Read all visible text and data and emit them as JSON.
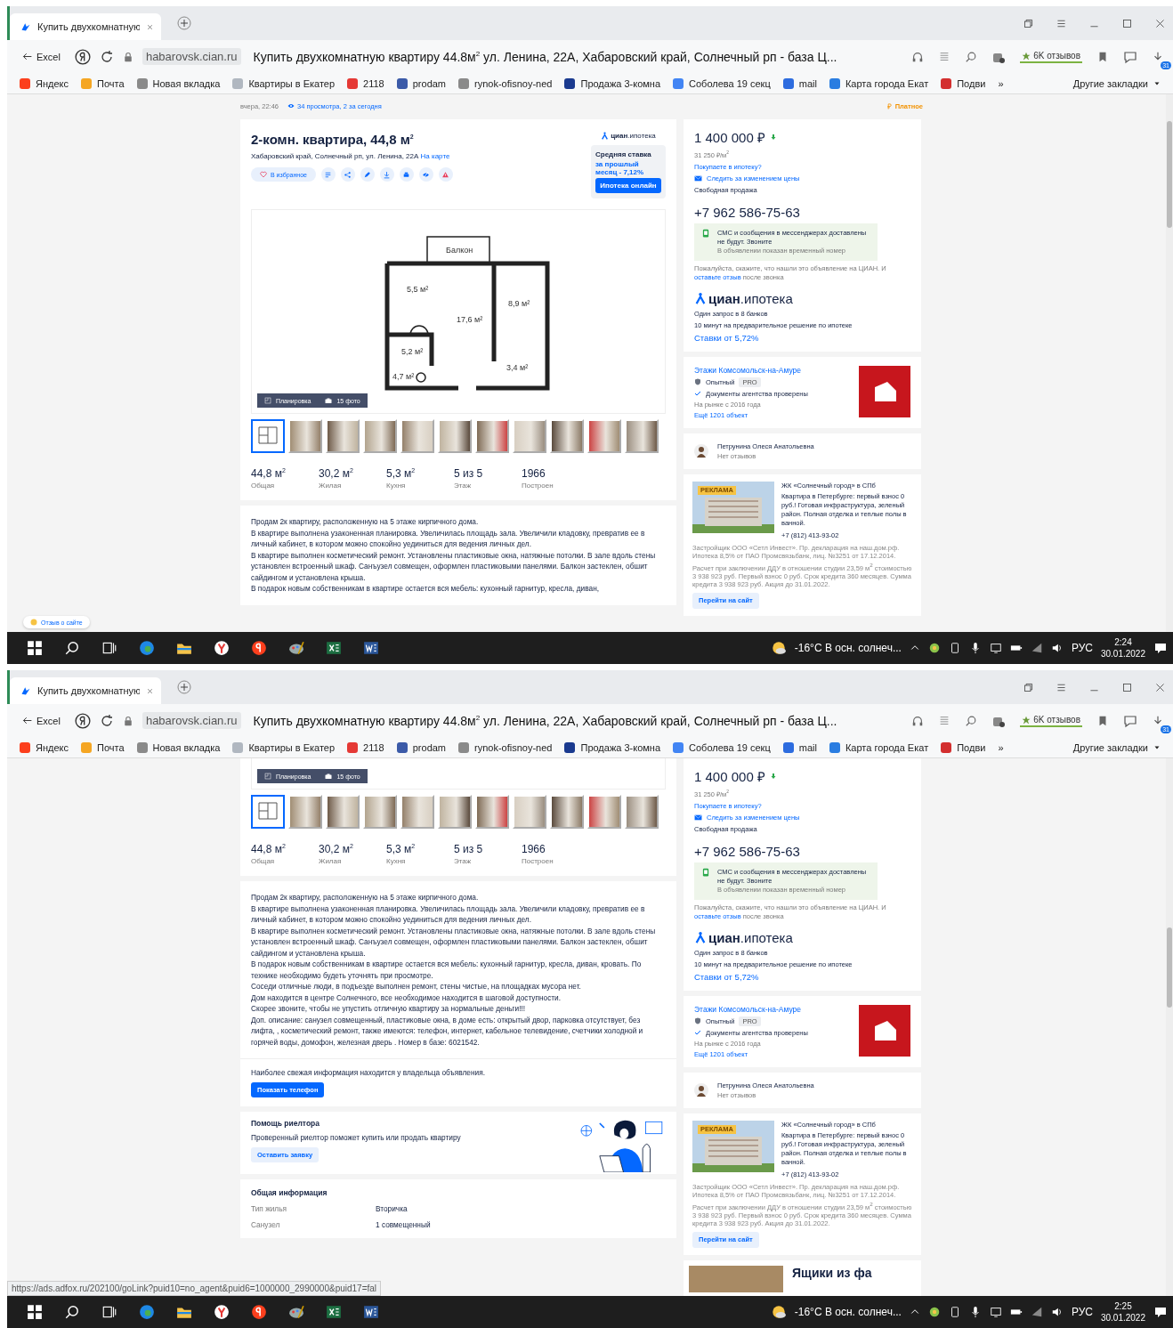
{
  "screens": [
    {
      "browser": {
        "tab_title": "Купить двухкомнатную",
        "back_label": "Excel",
        "domain": "habarovsk.cian.ru",
        "page_title": "Купить двухкомнатную квартиру 44.8м$^{2}$ ул. Ленина, 22А, Хабаровский край, Солнечный рп - база Ц...",
        "reviews": "6K отзывов",
        "download_badge": "31",
        "bookmarks": [
          {
            "label": "Яндекс",
            "color": "#fc3f1d"
          },
          {
            "label": "Почта",
            "color": "#f5a623"
          },
          {
            "label": "Новая вкладка",
            "color": "#8a8a8a"
          },
          {
            "label": "Квартиры в Екатер",
            "color": "#b0b7c0"
          },
          {
            "label": "2118",
            "color": "#e53935"
          },
          {
            "label": "prodam",
            "color": "#3b5aa8"
          },
          {
            "label": "rynok-ofisnoy-ned",
            "color": "#8a8a8a"
          },
          {
            "label": "Продажа 3-комна",
            "color": "#1a3a8f"
          },
          {
            "label": "Соболева 19 секц",
            "color": "#4285f4"
          },
          {
            "label": "mail",
            "color": "#2d6cdf"
          },
          {
            "label": "Карта города Екат",
            "color": "#2a7de1"
          },
          {
            "label": "Подви",
            "color": "#d32f2f"
          }
        ],
        "more": "»",
        "other_bookmarks": "Другие закладки"
      },
      "page": {
        "meta": {
          "posted": "вчера, 22:46",
          "views": "34 просмотра, 2 за сегодня",
          "paid": "Платное"
        },
        "header": {
          "title": "2-комн. квартира, 44,8 м$^{2}$",
          "address": "Хабаровский край, Солнечный рп, ул. Ленина, 22А",
          "map_link": "На карте",
          "favorite": "В избранное",
          "actions": [
            {
              "kind": "list"
            },
            {
              "kind": "share"
            },
            {
              "kind": "edit"
            },
            {
              "kind": "download"
            },
            {
              "kind": "print"
            },
            {
              "kind": "hide"
            },
            {
              "kind": "report"
            }
          ],
          "promo": {
            "brand": "циан",
            "suffix": ".ипотека",
            "rate_label": "Средняя ставка",
            "rate_value": "за прошлый месяц - 7,12%",
            "button": "Ипотека онлайн"
          }
        },
        "plan": {
          "labels": [
            "Балкон",
            "5,5 м²",
            "8,9 м²",
            "17,6 м²",
            "5,2 м²",
            "4,7 м²",
            "3,4 м²"
          ]
        },
        "gallery": {
          "plan_button": "Планировка",
          "photos_button": "15 фото",
          "thumbs": [
            {
              "kind": "plan",
              "selected": true
            },
            {
              "kind": "photo",
              "selected": false
            },
            {
              "kind": "photo",
              "selected": false
            },
            {
              "kind": "photo",
              "selected": false
            },
            {
              "kind": "photo",
              "selected": false
            },
            {
              "kind": "photo",
              "selected": false
            },
            {
              "kind": "photo",
              "selected": false
            },
            {
              "kind": "photo",
              "selected": false
            },
            {
              "kind": "photo",
              "selected": false
            },
            {
              "kind": "photo",
              "selected": false
            },
            {
              "kind": "photo",
              "selected": false
            }
          ]
        },
        "stats": [
          {
            "value": "44,8 м$^{2}$",
            "label": "Общая"
          },
          {
            "value": "30,2 м$^{2}$",
            "label": "Жилая"
          },
          {
            "value": "5,3 м$^{2}$",
            "label": "Кухня"
          },
          {
            "value": "5 из 5",
            "label": "Этаж"
          },
          {
            "value": "1966",
            "label": "Построен"
          }
        ],
        "description": [
          "Продам 2к квартиру, расположенную на 5 этаже кирпичного дома.",
          "В квартире выполнена узаконенная планировка. Увеличилась площадь зала. Увеличили кладовку, превратив ее в личный кабинет, в котором можно спокойно уединиться для ведения личных дел.",
          "В квартире выполнен косметический ремонт. Установлены пластиковые окна, натяжные потолки. В зале вдоль стены установлен встроенный шкаф. Санъузел совмещен, оформлен пластиковыми панелями. Балкон застеклен, обшит сайдингом и установлена крыша.",
          "В подарок новым собственникам в квартире остается вся мебель: кухонный гарнитур, кресла, диван,"
        ]
      },
      "sidebar": {
        "price": "1 400 000 ₽",
        "price_per_m2": "31 250 ₽/м$^{2}$",
        "mortgage_link": "Покупаете в ипотеку?",
        "watch_price": "Следить за изменением цены",
        "sale_type": "Свободная продажа",
        "phone": "+7 962 586-75-63",
        "notice": {
          "title": "СМС и сообщения в мессенджерах доставлены не будут. Звоните",
          "subtitle": "В объявлении показан временный номер"
        },
        "hint": {
          "before": "Пожалуйста, скажите, что нашли это объявление на ЦИАН. И ",
          "link": "оставьте отзыв",
          "after": " после звонка"
        },
        "cian": {
          "brand": "циан",
          "suffix": ".ипотека",
          "lines": [
            "Один запрос в 8 банков",
            "10 минут на предварительное решение по ипотеке"
          ],
          "rates": "Ставки от 5,72%"
        },
        "agency": {
          "name": "Этажи Комсомольск-на-Амуре",
          "level": "Опытный",
          "badge": "PRO",
          "verified": "Документы агентства проверены",
          "since": "На рынке с 2016 года",
          "more": "Ещё 1201 объект"
        },
        "agent": {
          "name": "Петрунина Олеся Анатольевна",
          "reviews": "Нет отзывов"
        },
        "ad": {
          "label": "РЕКЛАМА",
          "title": "ЖК «Солнечный город» в СПб",
          "text": "Квартира в Петербурге: первый взнос 0 руб.! Готовая инфраструктура, зеленый район. Полная отделка и теплые полы в ванной.",
          "phone": "+7 (812) 413-93-02",
          "disclaimer": "Застройщик ООО «Сетл Инвест». Пр. декларация на наш.дом.рф. Ипотека 8,5% от ПАО Промсвязьбанк, лиц. №3251 от 17.12.2014. Расчет при заключении ДДУ в отношении студии 23,59 м$^{2}$ стоимостью 3 938 923 руб. Первый взнос 0 руб. Срок кредита 360 месяцев. Сумма кредита 3 938 923 руб. Акция до 31.01.2022.",
          "button": "Перейти на сайт"
        }
      },
      "overlay": {
        "kind": "feedback",
        "text": "Отзыв о сайте"
      },
      "taskbar": {
        "weather": "-16°C  В осн. солнеч...",
        "lang": "РУС",
        "time": "2:24",
        "date": "30.01.2022"
      }
    },
    {
      "browser": {
        "tab_title": "Купить двухкомнатную",
        "back_label": "Excel",
        "domain": "habarovsk.cian.ru",
        "page_title": "Купить двухкомнатную квартиру 44.8м$^{2}$ ул. Ленина, 22А, Хабаровский край, Солнечный рп - база Ц...",
        "reviews": "6K отзывов",
        "download_badge": "31",
        "bookmarks": [
          {
            "label": "Яндекс",
            "color": "#fc3f1d"
          },
          {
            "label": "Почта",
            "color": "#f5a623"
          },
          {
            "label": "Новая вкладка",
            "color": "#8a8a8a"
          },
          {
            "label": "Квартиры в Екатер",
            "color": "#b0b7c0"
          },
          {
            "label": "2118",
            "color": "#e53935"
          },
          {
            "label": "prodam",
            "color": "#3b5aa8"
          },
          {
            "label": "rynok-ofisnoy-ned",
            "color": "#8a8a8a"
          },
          {
            "label": "Продажа 3-комна",
            "color": "#1a3a8f"
          },
          {
            "label": "Соболева 19 секц",
            "color": "#4285f4"
          },
          {
            "label": "mail",
            "color": "#2d6cdf"
          },
          {
            "label": "Карта города Екат",
            "color": "#2a7de1"
          },
          {
            "label": "Подви",
            "color": "#d32f2f"
          }
        ],
        "more": "»",
        "other_bookmarks": "Другие закладки"
      },
      "page": {
        "gallery": {
          "plan_button": "Планировка",
          "photos_button": "15 фото",
          "thumbs": [
            {
              "kind": "plan",
              "selected": true
            },
            {
              "kind": "photo",
              "selected": false
            },
            {
              "kind": "photo",
              "selected": false
            },
            {
              "kind": "photo",
              "selected": false
            },
            {
              "kind": "photo",
              "selected": false
            },
            {
              "kind": "photo",
              "selected": false
            },
            {
              "kind": "photo",
              "selected": false
            },
            {
              "kind": "photo",
              "selected": false
            },
            {
              "kind": "photo",
              "selected": false
            },
            {
              "kind": "photo",
              "selected": false
            },
            {
              "kind": "photo",
              "selected": false
            }
          ]
        },
        "stats": [
          {
            "value": "44,8 м$^{2}$",
            "label": "Общая"
          },
          {
            "value": "30,2 м$^{2}$",
            "label": "Жилая"
          },
          {
            "value": "5,3 м$^{2}$",
            "label": "Кухня"
          },
          {
            "value": "5 из 5",
            "label": "Этаж"
          },
          {
            "value": "1966",
            "label": "Построен"
          }
        ],
        "description": [
          "Продам 2к квартиру, расположенную на 5 этаже кирпичного дома.",
          "В квартире выполнена узаконенная планировка. Увеличилась площадь зала. Увеличили кладовку, превратив ее в личный кабинет, в котором можно спокойно уединиться для ведения личных дел.",
          "В квартире выполнен косметический ремонт. Установлены пластиковые окна, натяжные потолки. В зале вдоль стены установлен встроенный шкаф. Санъузел совмещен, оформлен пластиковыми панелями. Балкон застеклен, обшит сайдингом и установлена крыша.",
          "В подарок новым собственникам в квартире остается вся мебель: кухонный гарнитур, кресла, диван, кровать. По технике необходимо будеть уточнять при просмотре.",
          "Соседи отличные люди, в подъезде выполнен ремонт, стены чистые, на площадках мусора нет.",
          "Дом находится в центре Солнечного, все необходимое находится в шаговой доступности.",
          "Скорее звоните, чтобы не упустить отличную квартиру за нормальные деньги!!!",
          " Доп. описание: санузел совмещенный, пластиковые окна, в доме есть: открытый двор, парковка отсутствует, без лифта, , косметический ремонт, также имеются: телефон, интернет, кабельное телевидение, счетчики холодной и горячей воды, домофон, железная дверь . Номер в базе: 6021542."
        ],
        "owner": {
          "note": "Наиболее свежая информация находится у владельца объявления.",
          "button": "Показать телефон"
        },
        "realtor": {
          "title": "Помощь риелтора",
          "text": "Проверенный риелтор поможет купить или продать квартиру",
          "button": "Оставить заявку"
        },
        "general": {
          "title": "Общая информация",
          "rows": [
            {
              "label": "Тип жилья",
              "value": "Вторичка"
            },
            {
              "label": "Санузел",
              "value": "1 совмещенный"
            }
          ]
        }
      },
      "sidebar": {
        "price": "1 400 000 ₽",
        "price_per_m2": "31 250 ₽/м$^{2}$",
        "mortgage_link": "Покупаете в ипотеку?",
        "watch_price": "Следить за изменением цены",
        "sale_type": "Свободная продажа",
        "phone": "+7 962 586-75-63",
        "notice": {
          "title": "СМС и сообщения в мессенджерах доставлены не будут. Звоните",
          "subtitle": "В объявлении показан временный номер"
        },
        "hint": {
          "before": "Пожалуйста, скажите, что нашли это объявление на ЦИАН. И ",
          "link": "оставьте отзыв",
          "after": " после звонка"
        },
        "cian": {
          "brand": "циан",
          "suffix": ".ипотека",
          "lines": [
            "Один запрос в 8 банков",
            "10 минут на предварительное решение по ипотеке"
          ],
          "rates": "Ставки от 5,72%"
        },
        "agency": {
          "name": "Этажи Комсомольск-на-Амуре",
          "level": "Опытный",
          "badge": "PRO",
          "verified": "Документы агентства проверены",
          "since": "На рынке с 2016 года",
          "more": "Ещё 1201 объект"
        },
        "agent": {
          "name": "Петрунина Олеся Анатольевна",
          "reviews": "Нет отзывов"
        },
        "ad": {
          "label": "РЕКЛАМА",
          "title": "ЖК «Солнечный город» в СПб",
          "text": "Квартира в Петербурге: первый взнос 0 руб.! Готовая инфраструктура, зеленый район. Полная отделка и теплые полы в ванной.",
          "phone": "+7 (812) 413-93-02",
          "disclaimer": "Застройщик ООО «Сетл Инвест». Пр. декларация на наш.дом.рф. Ипотека 8,5% от ПАО Промсвязьбанк, лиц. №3251 от 17.12.2014. Расчет при заключении ДДУ в отношении студии 23,59 м$^{2}$ стоимостью 3 938 923 руб. Первый взнос 0 руб. Срок кредита 360 месяцев. Сумма кредита 3 938 923 руб. Акция до 31.01.2022.",
          "button": "Перейти на сайт"
        },
        "teaser": {
          "title": "Ящики из фа"
        }
      },
      "overlay": {
        "kind": "status",
        "text": "https://ads.adfox.ru/202100/goLink?puid10=no_agent&puid6=1000000_2990000&puid17=fal"
      },
      "taskbar": {
        "weather": "-16°C  В осн. солнеч...",
        "lang": "РУС",
        "time": "2:25",
        "date": "30.01.2022"
      }
    }
  ]
}
